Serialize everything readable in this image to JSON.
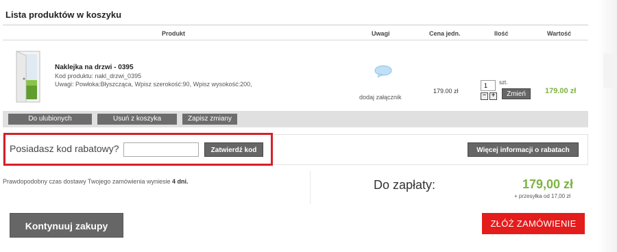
{
  "page": {
    "title": "Lista produktów w koszyku"
  },
  "table": {
    "headers": {
      "produkt": "Produkt",
      "uwagi": "Uwagi",
      "cena": "Cena jedn.",
      "ilosc": "Ilość",
      "wartosc": "Wartość"
    },
    "item": {
      "name": "Naklejka na drzwi - 0395",
      "code": "Kod produktu: nakl_drzwi_0395",
      "notes": "Uwagi: Powłoka:Błyszcząca, Wpisz szerokość:90, Wpisz wysokość:200,",
      "attach_label": "dodaj załącznik",
      "unit_price": "179.00 zł",
      "quantity": "1",
      "quantity_unit": "szt.",
      "minus": "−",
      "plus": "+",
      "change_label": "Zmień",
      "line_total": "179.00 zł"
    }
  },
  "actions": {
    "favorites": "Do ulubionych",
    "remove": "Usuń z koszyka",
    "save": "Zapisz zmiany"
  },
  "coupon": {
    "label": "Posiadasz kod rabatowy?",
    "value": "",
    "submit": "Zatwierdź kod",
    "more_info": "Więcej informacji o rabatach"
  },
  "summary": {
    "delivery_prefix": "Prawdopodobny czas dostawy Twojego zamówienia wyniesie",
    "delivery_days": "4 dni.",
    "pay_label": "Do zapłaty:",
    "pay_amount": "179,00 zł",
    "shipping_note": "+ przesyłka od 17,00 zł"
  },
  "buttons": {
    "continue": "Kontynuuj zakupy",
    "order": "ZŁÓŻ ZAMÓWIENIE"
  },
  "colors": {
    "price_green": "#7cb342",
    "order_red": "#e41c1c",
    "highlight_red": "#d61f26",
    "button_gray": "#666666"
  }
}
